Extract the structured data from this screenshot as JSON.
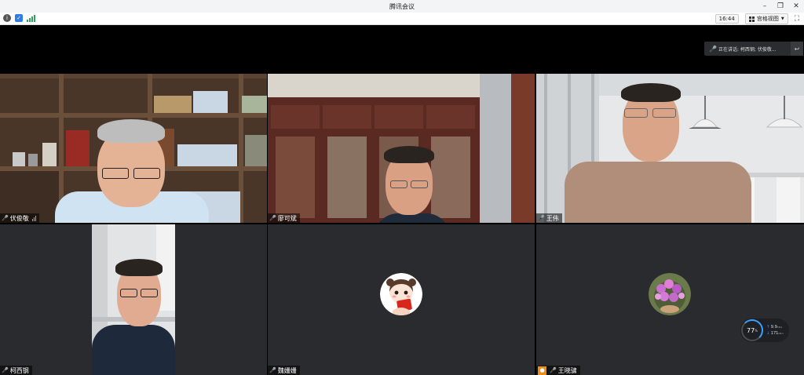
{
  "app": {
    "title": "腾讯会议"
  },
  "toolbar": {
    "clock": "16:44",
    "view_label": "宫格视图"
  },
  "speaking": {
    "text": "正在讲话: 柯西钢; 伏俊敬..."
  },
  "participants": [
    {
      "name": "伏俊敬"
    },
    {
      "name": "廖可斌"
    },
    {
      "name": "王伟"
    },
    {
      "name": "柯西钢"
    },
    {
      "name": "魏姗姗"
    },
    {
      "name": "王晓骕"
    }
  ],
  "network": {
    "percent": "77",
    "percent_unit": "%",
    "upload": "9.9",
    "upload_unit": "KB/s",
    "download": "171",
    "download_unit": "KB/s"
  },
  "colors": {
    "accent": "#2ea043",
    "host_badge": "#f08c1a",
    "tile_bg": "#2a2b2e"
  }
}
